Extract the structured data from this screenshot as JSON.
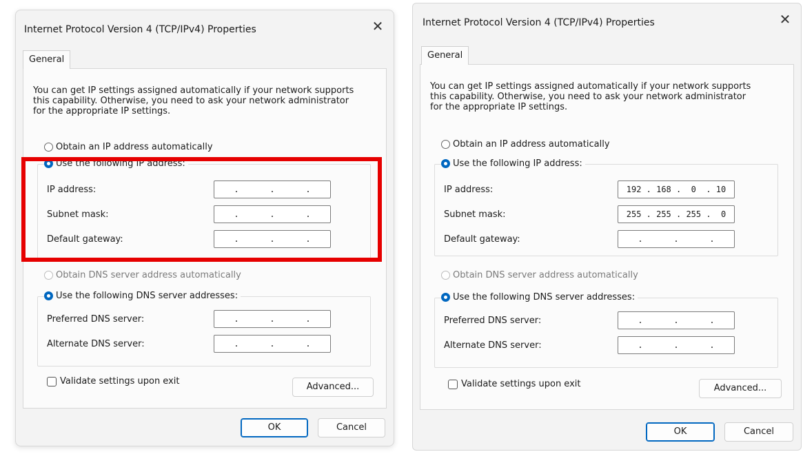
{
  "dialogs": [
    {
      "title": "Internet Protocol Version 4 (TCP/IPv4) Properties",
      "close_glyph": "✕",
      "tab": "General",
      "description": "You can get IP settings assigned automatically if your network supports this capability. Otherwise, you need to ask your network administrator for the appropriate IP settings.",
      "obtain_ip_auto": "Obtain an IP address automatically",
      "use_following_ip": "Use the following IP address:",
      "ip_label": "IP address:",
      "ip_value": "",
      "subnet_label": "Subnet mask:",
      "subnet_value": "",
      "gateway_label": "Default gateway:",
      "gateway_value": "",
      "obtain_dns_auto": "Obtain DNS server address automatically",
      "use_following_dns": "Use the following DNS server addresses:",
      "preferred_dns_label": "Preferred DNS server:",
      "preferred_dns_value": "",
      "alternate_dns_label": "Alternate DNS server:",
      "alternate_dns_value": "",
      "validate_label": "Validate settings upon exit",
      "advanced_label": "Advanced...",
      "ok_label": "OK",
      "cancel_label": "Cancel"
    },
    {
      "title": "Internet Protocol Version 4 (TCP/IPv4) Properties",
      "close_glyph": "✕",
      "tab": "General",
      "description": "You can get IP settings assigned automatically if your network supports this capability. Otherwise, you need to ask your network administrator for the appropriate IP settings.",
      "obtain_ip_auto": "Obtain an IP address automatically",
      "use_following_ip": "Use the following IP address:",
      "ip_label": "IP address:",
      "ip_value": "192 . 168 .  0  . 10",
      "subnet_label": "Subnet mask:",
      "subnet_value": "255 . 255 . 255 .  0",
      "gateway_label": "Default gateway:",
      "gateway_value": "",
      "obtain_dns_auto": "Obtain DNS server address automatically",
      "use_following_dns": "Use the following DNS server addresses:",
      "preferred_dns_label": "Preferred DNS server:",
      "preferred_dns_value": "",
      "alternate_dns_label": "Alternate DNS server:",
      "alternate_dns_value": "",
      "validate_label": "Validate settings upon exit",
      "advanced_label": "Advanced...",
      "ok_label": "OK",
      "cancel_label": "Cancel"
    }
  ],
  "colors": {
    "accent": "#0067c0",
    "highlight": "#e60000"
  }
}
